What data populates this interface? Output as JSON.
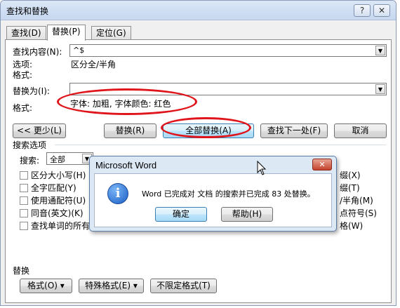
{
  "window": {
    "title": "查找和替换",
    "help_glyph": "?",
    "close_glyph": "✕"
  },
  "tabs": [
    {
      "label": "查找(D)",
      "active": false
    },
    {
      "label": "替换(P)",
      "active": true
    },
    {
      "label": "定位(G)",
      "active": false
    }
  ],
  "find": {
    "label": "查找内容(N):",
    "value": "^$",
    "options_label": "选项:",
    "options_value": "区分全/半角",
    "format_label": "格式:"
  },
  "replace": {
    "label": "替换为(I):",
    "value": "",
    "format_label": "格式:",
    "format_value": "字体: 加粗, 字体颜色: 红色"
  },
  "buttons": {
    "less": "<< 更少(L)",
    "replace": "替换(R)",
    "replace_all": "全部替换(A)",
    "find_next": "查找下一处(F)",
    "cancel": "取消"
  },
  "search_options": {
    "title": "搜索选项",
    "search_label": "搜索:",
    "search_value": "全部",
    "left_checks": [
      "区分大小写(H)",
      "全字匹配(Y)",
      "使用通配符(U)",
      "同音(英文)(K)",
      "查找单词的所有"
    ],
    "right_checks": [
      "缀(X)",
      "缀(T)",
      "/半角(M)",
      "点符号(S)",
      "格(W)"
    ]
  },
  "replace_section": {
    "title": "替换",
    "format_button": "格式(O) ▾",
    "special_button": "特殊格式(E) ▾",
    "no_format_button": "不限定格式(T)"
  },
  "message_box": {
    "title": "Microsoft Word",
    "close_glyph": "✕",
    "icon_glyph": "i",
    "text": "Word 已完成对 文档 的搜索并已完成 83 处替换。",
    "ok": "确定",
    "help": "帮助(H)"
  },
  "colors": {
    "annotation": "#e0151b",
    "title_bar": "#c6d7ef",
    "info_icon": "#1b5fc6"
  }
}
